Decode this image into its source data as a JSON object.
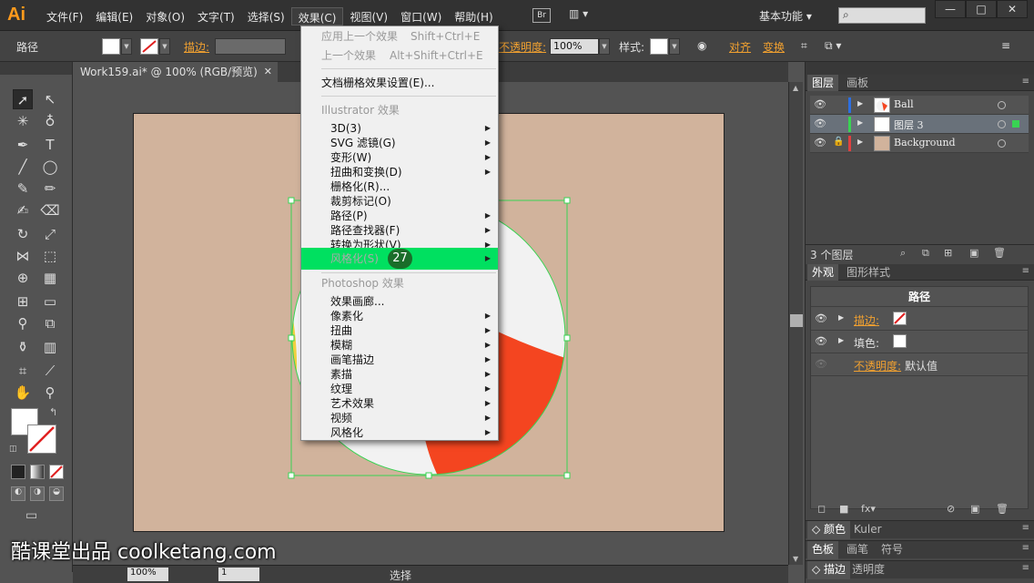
{
  "app": {
    "logo": "Ai",
    "workspace": "基本功能",
    "bridge": "Br"
  },
  "menubar": {
    "items": [
      "文件(F)",
      "编辑(E)",
      "对象(O)",
      "文字(T)",
      "选择(S)",
      "效果(C)",
      "视图(V)",
      "窗口(W)",
      "帮助(H)"
    ],
    "active_index": 5
  },
  "window_buttons": [
    "—",
    "□",
    "✕"
  ],
  "controlbar": {
    "object_type": "路径",
    "stroke_label": "描边:",
    "opacity_label": "不透明度:",
    "opacity_value": "100%",
    "style_label": "样式:",
    "align_label": "对齐",
    "transform_label": "变换"
  },
  "document_tab": {
    "title": "Work159.ai* @ 100% (RGB/预览)",
    "close": "✕"
  },
  "effect_menu": {
    "apply_last": {
      "label": "应用上一个效果",
      "shortcut": "Shift+Ctrl+E"
    },
    "last_effect": {
      "label": "上一个效果",
      "shortcut": "Alt+Shift+Ctrl+E"
    },
    "raster_settings": "文档栅格效果设置(E)...",
    "illustrator_header": "Illustrator 效果",
    "illustrator_items": [
      "3D(3)",
      "SVG 滤镜(G)",
      "变形(W)",
      "扭曲和变换(D)",
      "栅格化(R)...",
      "裁剪标记(O)",
      "路径(P)",
      "路径查找器(F)",
      "转换为形状(V)",
      "风格化(S)"
    ],
    "photoshop_header": "Photoshop 效果",
    "photoshop_items": [
      "效果画廊...",
      "像素化",
      "扭曲",
      "模糊",
      "画笔描边",
      "素描",
      "纹理",
      "艺术效果",
      "视频",
      "风格化"
    ],
    "step_badge": "27"
  },
  "layers_panel": {
    "tabs": [
      "图层",
      "画板"
    ],
    "layers": [
      {
        "name": "Ball",
        "color": "#2d6fe0"
      },
      {
        "name": "图层 3",
        "color": "#39d353"
      },
      {
        "name": "Background",
        "color": "#e04040"
      }
    ],
    "count": "3 个图层"
  },
  "appearance_panel": {
    "tabs": [
      "外观",
      "图形样式"
    ],
    "title": "路径",
    "stroke_label": "描边:",
    "fill_label": "填色:",
    "opacity_label": "不透明度:",
    "opacity_value": "默认值"
  },
  "collapsed_panels": [
    {
      "tabs": [
        "颜色",
        "Kuler"
      ]
    },
    {
      "tabs": [
        "色板",
        "画笔",
        "符号"
      ]
    },
    {
      "tabs": [
        "描边",
        "透明度"
      ]
    }
  ],
  "statusbar": {
    "zoom": "100%",
    "page": "1",
    "tool": "选择"
  },
  "watermark": "酷课堂出品 coolketang.com",
  "colors": {
    "artboard": "#d1b39c",
    "ball_red": "#f44520",
    "ball_white": "#f2f2f2",
    "ball_yellow": "#f0d040",
    "highlight": "#00e060",
    "selection": "#39d353"
  }
}
